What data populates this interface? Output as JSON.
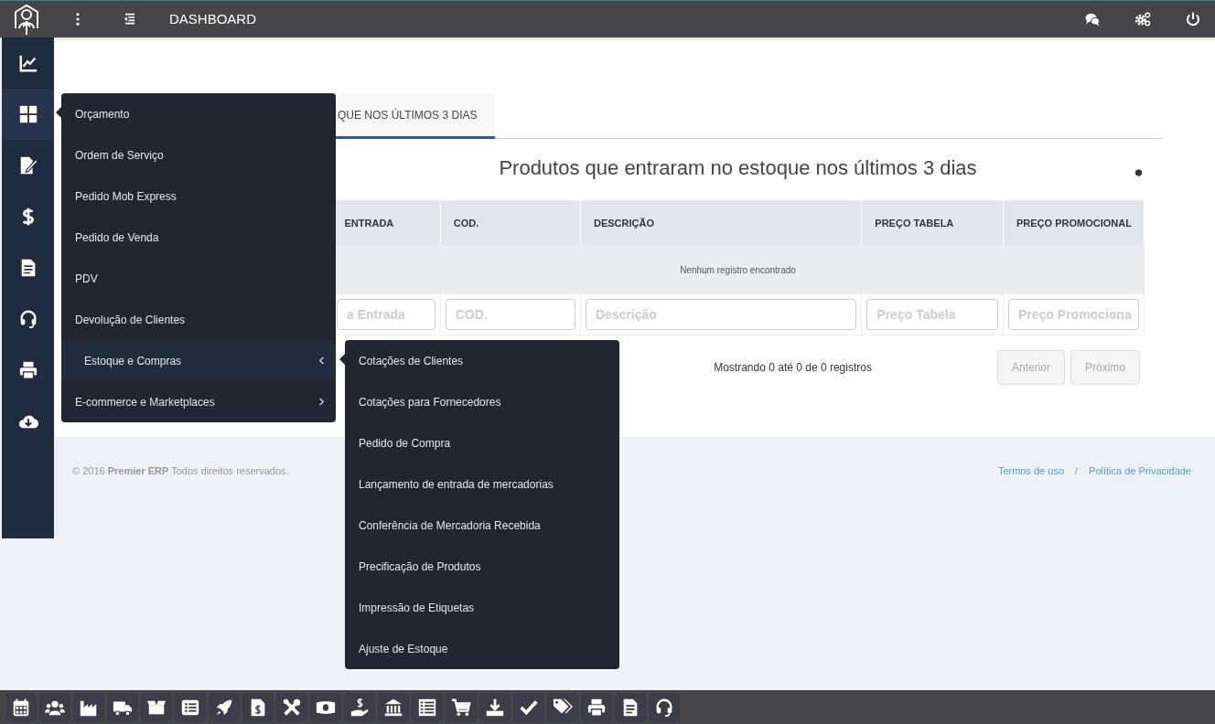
{
  "topbar": {
    "title": "DASHBOARD",
    "left_icons": [
      {
        "kind": "dots"
      },
      {
        "kind": "indent"
      }
    ],
    "right_icons": [
      {
        "kind": "chat"
      },
      {
        "kind": "gears"
      },
      {
        "kind": "power"
      }
    ]
  },
  "sidebar": {
    "items": [
      {
        "kind": "chart",
        "selected": false
      },
      {
        "kind": "grid",
        "selected": true
      },
      {
        "kind": "edit",
        "selected": false
      },
      {
        "kind": "dollar",
        "selected": false
      },
      {
        "kind": "document",
        "selected": false
      },
      {
        "kind": "headset",
        "selected": false
      },
      {
        "kind": "printer",
        "selected": false
      },
      {
        "kind": "cloud",
        "selected": false
      }
    ]
  },
  "tabs": [
    {
      "label": "QUE NOS ÚLTIMOS 3 DIAS",
      "selected": true
    }
  ],
  "panel": {
    "title": "Produtos que entraram no estoque nos últimos 3 dias",
    "table": {
      "columns": [
        "ENTRADA",
        "COD.",
        "DESCRIÇÃO",
        "PREÇO TABELA",
        "PREÇO PROMOCIONAL"
      ],
      "empty_message": "Nenhum registro encontrado",
      "filters": [
        {
          "placeholder": "a Entrada"
        },
        {
          "placeholder": "COD."
        },
        {
          "placeholder": "Descrição"
        },
        {
          "placeholder": "Preço Tabela"
        },
        {
          "placeholder": "Preço Promociona"
        }
      ]
    },
    "info": "Mostrando 0 até 0 de 0 registros",
    "pagination": [
      {
        "label": "Anterior",
        "disabled": true
      },
      {
        "label": "Próximo",
        "disabled": true
      }
    ]
  },
  "footer": {
    "copyright": "© 2016 **Premier ERP** Todos direitos reservados.",
    "links": [
      "Termos de uso",
      "Política de Privacidade"
    ],
    "separator": "/"
  },
  "menu": {
    "items": [
      {
        "label": "Orçamento",
        "kind": "link",
        "selected": false
      },
      {
        "label": "Ordem de Serviço",
        "kind": "link",
        "selected": false
      },
      {
        "label": "Pedido Mob Express",
        "kind": "link",
        "selected": false
      },
      {
        "label": "Pedido de Venda",
        "kind": "link",
        "selected": false
      },
      {
        "label": "PDV",
        "kind": "link",
        "selected": false
      },
      {
        "label": "Devolução de Clientes",
        "kind": "link",
        "selected": false
      },
      {
        "label": "Estoque e Compras",
        "kind": "submenu",
        "selected": true,
        "expanded": true
      },
      {
        "label": "E-commerce e Marketplaces",
        "kind": "submenu",
        "selected": false,
        "expanded": false
      }
    ]
  },
  "submenu": {
    "items": [
      "Cotações de Clientes",
      "Cotações para Fornecedores",
      "Pedido de Compra",
      "Lançamento de entrada de mercadorias",
      "Conferência de Mercadoria Recebida",
      "Precificação de Produtos",
      "Impressão de Etiquetas",
      "Ajuste de Estoque"
    ]
  },
  "taskbar": {
    "items": [
      {
        "kind": "calendar"
      },
      {
        "kind": "users"
      },
      {
        "kind": "factory"
      },
      {
        "kind": "truck"
      },
      {
        "kind": "box"
      },
      {
        "kind": "list"
      },
      {
        "kind": "rocket"
      },
      {
        "kind": "invoice"
      },
      {
        "kind": "tools"
      },
      {
        "kind": "money"
      },
      {
        "kind": "hand"
      },
      {
        "kind": "bank"
      },
      {
        "kind": "table"
      },
      {
        "kind": "cart"
      },
      {
        "kind": "download"
      },
      {
        "kind": "check"
      },
      {
        "kind": "tags"
      },
      {
        "kind": "printer"
      },
      {
        "kind": "document"
      },
      {
        "kind": "headset"
      }
    ]
  }
}
